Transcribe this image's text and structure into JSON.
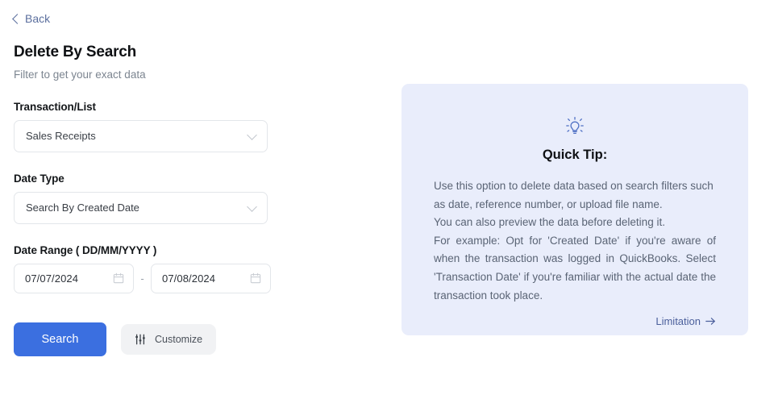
{
  "nav": {
    "back_label": "Back",
    "back_icon": "chevron-left-icon"
  },
  "header": {
    "title": "Delete By Search",
    "subtitle": "Filter to get your exact data"
  },
  "form": {
    "transaction": {
      "label": "Transaction/List",
      "value": "Sales Receipts",
      "icon": "chevron-down-icon"
    },
    "date_type": {
      "label": "Date Type",
      "value": "Search By Created Date",
      "icon": "chevron-down-icon"
    },
    "date_range": {
      "label": "Date Range ( DD/MM/YYYY )",
      "start_value": "07/07/2024",
      "end_value": "07/08/2024",
      "separator": "-",
      "icon": "calendar-icon"
    }
  },
  "actions": {
    "search_label": "Search",
    "customize_label": "Customize",
    "customize_icon": "sliders-icon",
    "search_color": "#3b6fe0",
    "customize_color": "#f1f2f4"
  },
  "tip": {
    "icon": "lightbulb-icon",
    "title": "Quick Tip:",
    "line1": "Use this option to delete data based on search filters such as date, reference number, or upload file name.",
    "line2": "You can also preview the data before deleting it.",
    "line3": "For example: Opt for 'Created Date' if you're aware of when the transaction was logged in QuickBooks. Select 'Transaction Date' if you're familiar with the actual date the transaction took place.",
    "link_label": "Limitation",
    "link_icon": "arrow-right-icon",
    "background_color": "#e9edfb",
    "link_color": "#4b5f9b"
  }
}
